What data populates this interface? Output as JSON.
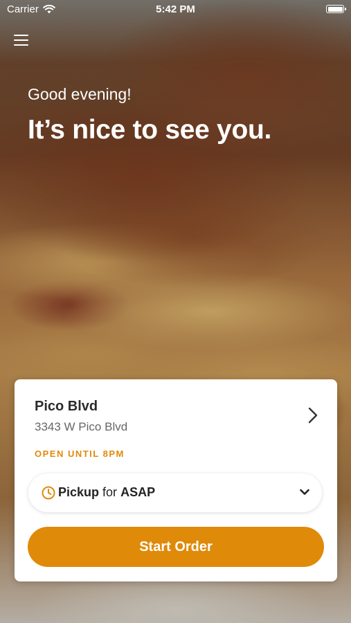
{
  "status_bar": {
    "carrier": "Carrier",
    "time": "5:42 PM",
    "battery_level": 1.0
  },
  "header": {
    "greeting": "Good evening!",
    "headline": "It’s nice to see you."
  },
  "location": {
    "name": "Pico Blvd",
    "address": "3343 W Pico Blvd",
    "hours": "OPEN UNTIL 8PM"
  },
  "order_mode": {
    "mode": "Pickup",
    "connector": "for",
    "time": "ASAP"
  },
  "actions": {
    "start_order_label": "Start Order"
  },
  "colors": {
    "accent": "#e08a0a",
    "card": "#ffffff",
    "text_dark": "#2b2b2b",
    "text_muted": "#666666"
  },
  "icons": {
    "menu": "hamburger-menu-icon",
    "wifi": "wifi-icon",
    "battery": "battery-icon",
    "chevron_right": "chevron-right-icon",
    "clock": "clock-icon",
    "chevron_down": "chevron-down-icon"
  }
}
